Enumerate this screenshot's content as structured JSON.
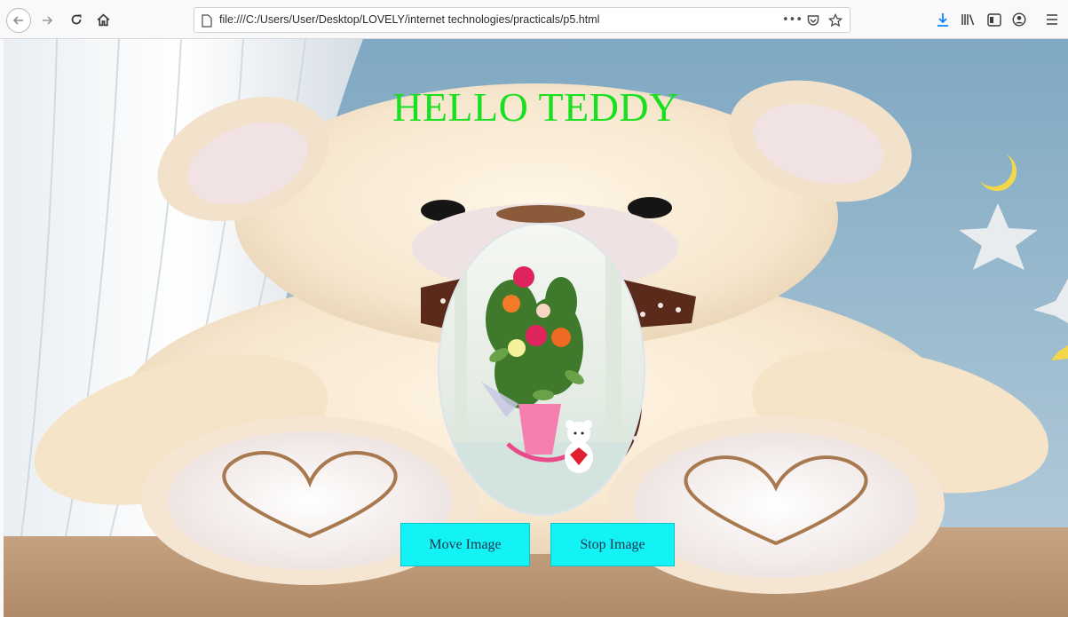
{
  "browser": {
    "url": "file:///C:/Users/User/Desktop/LOVELY/internet technologies/practicals/p5.html",
    "page_actions_label": "•••"
  },
  "page": {
    "heading": "HELLO TEDDY",
    "buttons": {
      "move_label": "Move Image",
      "stop_label": "Stop Image"
    }
  },
  "colors": {
    "heading": "#18e01f",
    "button_bg": "#13f3f6",
    "download_icon": "#0a84ff"
  }
}
